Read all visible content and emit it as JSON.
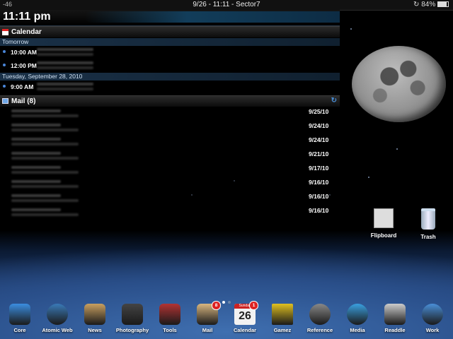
{
  "status_bar": {
    "carrier": "-46",
    "center": "9/26 - 11:11 - Sector7",
    "battery": "84%"
  },
  "clock": {
    "time": "11:11 pm"
  },
  "calendar": {
    "title": "Calendar",
    "groups": [
      {
        "day": "Tomorrow",
        "events": [
          {
            "time": "10:00 AM"
          },
          {
            "time": "12:00 PM"
          }
        ]
      },
      {
        "day": "Tuesday, September 28, 2010",
        "events": [
          {
            "time": "9:00 AM"
          }
        ]
      }
    ]
  },
  "mail": {
    "title": "Mail (8)",
    "messages": [
      {
        "date": "9/25/10"
      },
      {
        "date": "9/24/10"
      },
      {
        "date": "9/24/10"
      },
      {
        "date": "9/21/10"
      },
      {
        "date": "9/17/10"
      },
      {
        "date": "9/16/10"
      },
      {
        "date": "9/16/10"
      },
      {
        "date": "9/16/10"
      }
    ]
  },
  "desktop": {
    "flipboard": "Flipboard",
    "trash": "Trash"
  },
  "dock": [
    {
      "label": "Core",
      "icon": "apple-icon",
      "color": "#3b8de0"
    },
    {
      "label": "Atomic Web",
      "icon": "globe-icon",
      "color": "#3a7ab8"
    },
    {
      "label": "News",
      "icon": "news-icon",
      "color": "#c9a060"
    },
    {
      "label": "Photography",
      "icon": "camera-icon",
      "color": "#444444"
    },
    {
      "label": "Tools",
      "icon": "tools-icon",
      "color": "#b33333"
    },
    {
      "label": "Mail",
      "icon": "envelope-icon",
      "color": "#d9b780",
      "badge": "8"
    },
    {
      "label": "Calendar",
      "icon": "calendar-icon",
      "color": "#eeeeee",
      "badge": "1",
      "day": "26",
      "weekday": "Sunday"
    },
    {
      "label": "Gamez",
      "icon": "blocks-icon",
      "color": "#e0c020"
    },
    {
      "label": "Reference",
      "icon": "magnifier-icon",
      "color": "#888888"
    },
    {
      "label": "Media",
      "icon": "play-icon",
      "color": "#3aa0e0"
    },
    {
      "label": "Readdle",
      "icon": "documents-icon",
      "color": "#cccccc"
    },
    {
      "label": "Work",
      "icon": "house-icon",
      "color": "#4a8fd8"
    }
  ]
}
